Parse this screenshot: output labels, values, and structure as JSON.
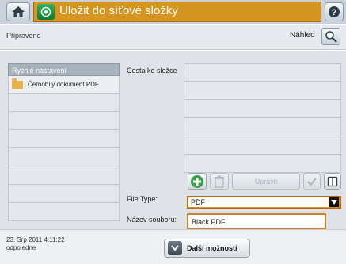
{
  "header": {
    "title": "Uložit do síťové složky",
    "home_icon": "home-icon",
    "help_icon": "help-icon",
    "app_icon": "network-folder-icon"
  },
  "status": {
    "text": "Připraveno",
    "preview_label": "Náhled"
  },
  "quick_settings": {
    "header": "Rychlé nastavení",
    "items": [
      "Černobílý dokument PDF"
    ]
  },
  "folder_path": {
    "label": "Cesta ke složce"
  },
  "toolbar": {
    "edit_label": "Upravit"
  },
  "file_type": {
    "label": "File Type:",
    "value": "PDF"
  },
  "file_name": {
    "label": "Název souboru:",
    "value": "Black PDF"
  },
  "footer": {
    "date": "23. Srp 2011 4:11:22",
    "period": "odpoledne",
    "more_options": "Další možnosti"
  },
  "colors": {
    "title_panel": "#d69520",
    "selection_border": "#c7832d"
  }
}
